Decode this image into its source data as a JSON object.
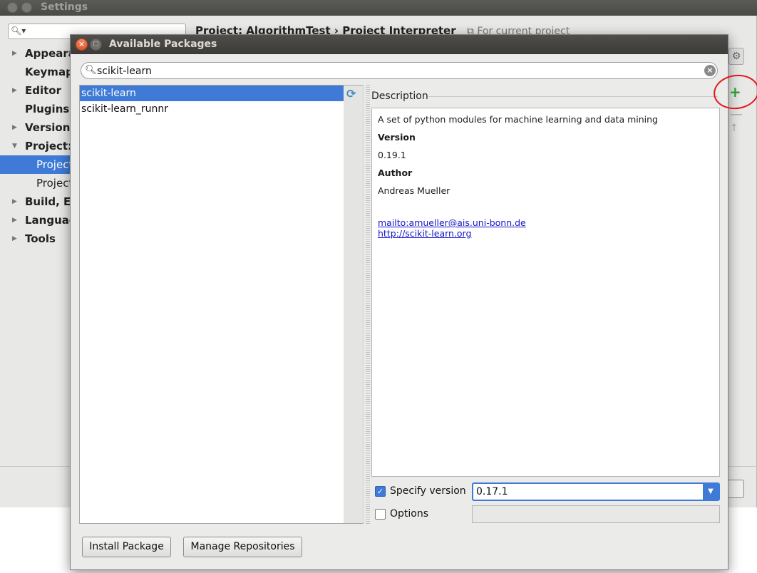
{
  "settings": {
    "title": "Settings",
    "tree": [
      {
        "label": "Appearance",
        "arrow": "▶"
      },
      {
        "label": "Keymap",
        "arrow": ""
      },
      {
        "label": "Editor",
        "arrow": "▶"
      },
      {
        "label": "Plugins",
        "arrow": ""
      },
      {
        "label": "Version Control",
        "arrow": "▶"
      },
      {
        "label": "Project: AlgorithmTest",
        "arrow": "▼"
      },
      {
        "label": "Project Interpreter",
        "arrow": ""
      },
      {
        "label": "Project Structure",
        "arrow": ""
      },
      {
        "label": "Build, Execution, Deployment",
        "arrow": "▶"
      },
      {
        "label": "Languages & Frameworks",
        "arrow": "▶"
      },
      {
        "label": "Tools",
        "arrow": "▶"
      }
    ],
    "breadcrumb": {
      "project": "Project: AlgorithmTest",
      "separator": "›",
      "page": "Project Interpreter",
      "scope": "For current project"
    }
  },
  "dialog": {
    "title": "Available Packages",
    "search": {
      "value": "scikit-learn"
    },
    "packages": [
      {
        "name": "scikit-learn",
        "selected": true
      },
      {
        "name": "scikit-learn_runnr",
        "selected": false
      }
    ],
    "description": {
      "header": "Description",
      "summary": "A set of python modules for machine learning and data mining",
      "version_label": "Version",
      "version_value": "0.19.1",
      "author_label": "Author",
      "author_value": "Andreas Mueller",
      "links": [
        "mailto:amueller@ais.uni-bonn.de",
        "http://scikit-learn.org"
      ]
    },
    "specify_version": {
      "label": "Specify version",
      "checked": true,
      "value": "0.17.1"
    },
    "options": {
      "label": "Options",
      "checked": false,
      "value": ""
    },
    "buttons": {
      "install": "Install Package",
      "manage": "Manage Repositories"
    }
  },
  "colors": {
    "accent": "#3e7ad6",
    "annotation": "#e3161b",
    "add": "#2e9a2e"
  }
}
